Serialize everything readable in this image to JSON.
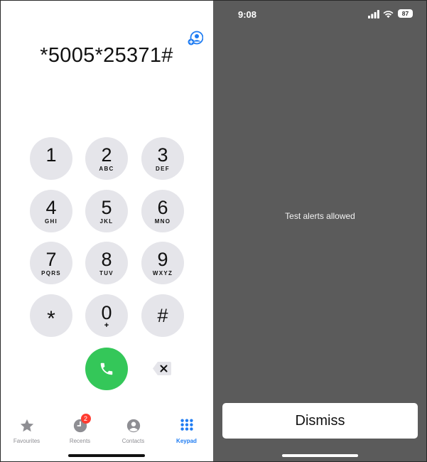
{
  "dialer": {
    "number": "*5005*25371#",
    "keys": [
      {
        "digit": "1",
        "letters": ""
      },
      {
        "digit": "2",
        "letters": "ABC"
      },
      {
        "digit": "3",
        "letters": "DEF"
      },
      {
        "digit": "4",
        "letters": "GHI"
      },
      {
        "digit": "5",
        "letters": "JKL"
      },
      {
        "digit": "6",
        "letters": "MNO"
      },
      {
        "digit": "7",
        "letters": "PQRS"
      },
      {
        "digit": "8",
        "letters": "TUV"
      },
      {
        "digit": "9",
        "letters": "WXYZ"
      },
      {
        "digit": "*",
        "letters": ""
      },
      {
        "digit": "0",
        "letters": "+"
      },
      {
        "digit": "#",
        "letters": ""
      }
    ],
    "call_color": "#34c759"
  },
  "tabbar": {
    "tabs": [
      {
        "label": "Favourites",
        "icon": "star-icon"
      },
      {
        "label": "Recents",
        "icon": "clock-icon",
        "badge": "2"
      },
      {
        "label": "Contacts",
        "icon": "person-circle-icon"
      },
      {
        "label": "Keypad",
        "icon": "keypad-grid-icon",
        "active": true
      }
    ],
    "accent": "#1f7cf2"
  },
  "status_bar": {
    "time": "9:08",
    "battery": "87"
  },
  "alert": {
    "message": "Test alerts allowed",
    "dismiss_label": "Dismiss"
  }
}
